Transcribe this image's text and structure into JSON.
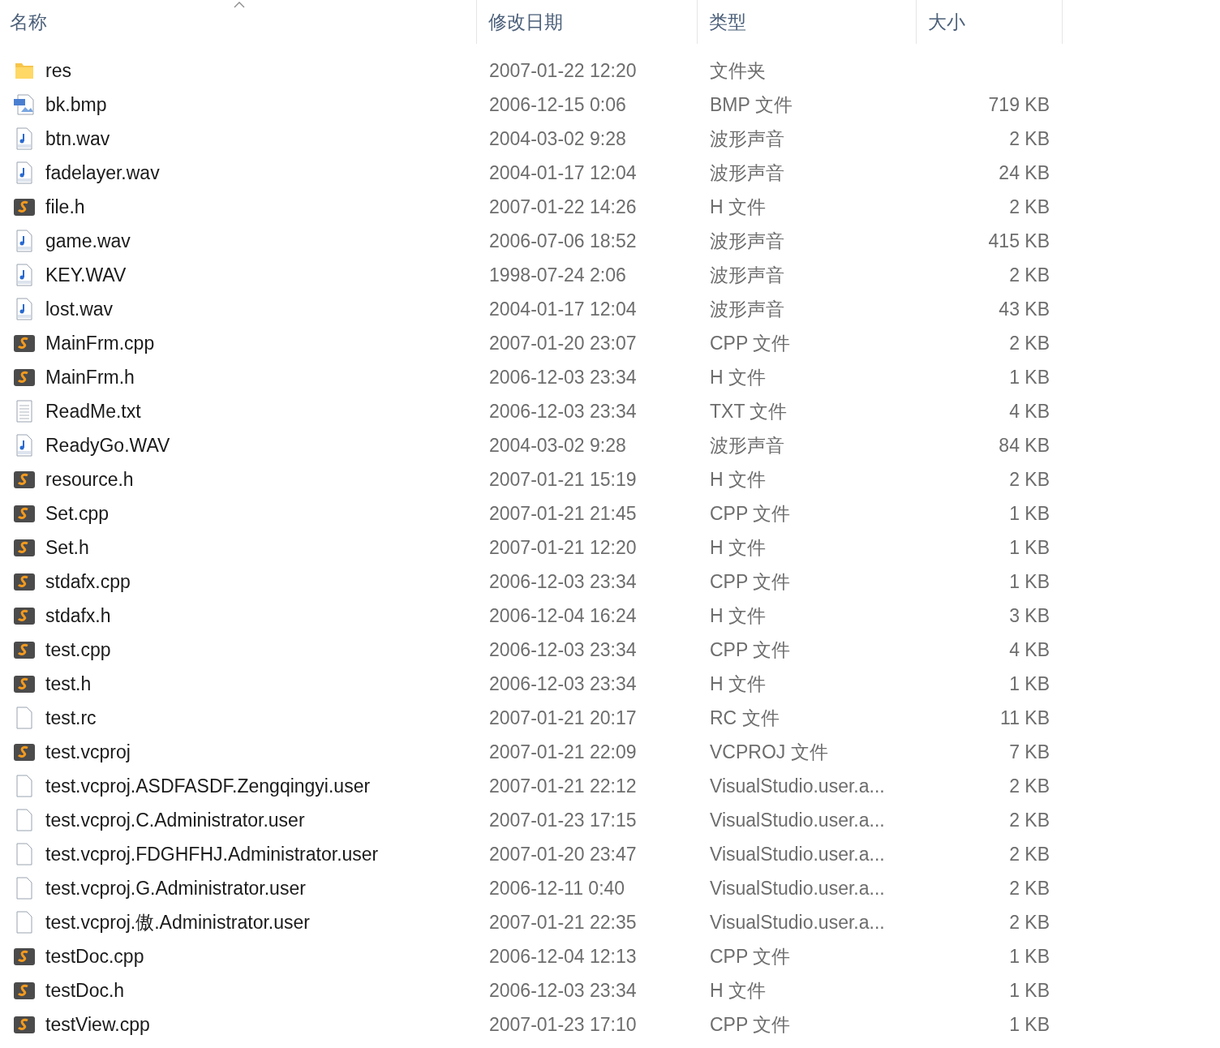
{
  "columns": [
    {
      "label": "名称",
      "sorted": true
    },
    {
      "label": "修改日期",
      "sorted": false
    },
    {
      "label": "类型",
      "sorted": false
    },
    {
      "label": "大小",
      "sorted": false
    }
  ],
  "rows": [
    {
      "kind": "folder",
      "name": "res",
      "date": "2007-01-22 12:20",
      "type": "文件夹"
    },
    {
      "kind": "bmp",
      "name": "bk.bmp",
      "date": "2006-12-15 0:06",
      "type": "BMP 文件",
      "size": "719 KB"
    },
    {
      "kind": "wav",
      "name": "btn.wav",
      "date": "2004-03-02 9:28",
      "type": "波形声音",
      "size": "2 KB"
    },
    {
      "kind": "wav",
      "name": "fadelayer.wav",
      "date": "2004-01-17 12:04",
      "type": "波形声音",
      "size": "24 KB"
    },
    {
      "kind": "code",
      "name": "file.h",
      "date": "2007-01-22 14:26",
      "type": "H 文件",
      "size": "2 KB"
    },
    {
      "kind": "wav",
      "name": "game.wav",
      "date": "2006-07-06 18:52",
      "type": "波形声音",
      "size": "415 KB"
    },
    {
      "kind": "wav",
      "name": "KEY.WAV",
      "date": "1998-07-24 2:06",
      "type": "波形声音",
      "size": "2 KB"
    },
    {
      "kind": "wav",
      "name": "lost.wav",
      "date": "2004-01-17 12:04",
      "type": "波形声音",
      "size": "43 KB"
    },
    {
      "kind": "code",
      "name": "MainFrm.cpp",
      "date": "2007-01-20 23:07",
      "type": "CPP 文件",
      "size": "2 KB"
    },
    {
      "kind": "code",
      "name": "MainFrm.h",
      "date": "2006-12-03 23:34",
      "type": "H 文件",
      "size": "1 KB"
    },
    {
      "kind": "text",
      "name": "ReadMe.txt",
      "date": "2006-12-03 23:34",
      "type": "TXT 文件",
      "size": "4 KB"
    },
    {
      "kind": "wav",
      "name": "ReadyGo.WAV",
      "date": "2004-03-02 9:28",
      "type": "波形声音",
      "size": "84 KB"
    },
    {
      "kind": "code",
      "name": "resource.h",
      "date": "2007-01-21 15:19",
      "type": "H 文件",
      "size": "2 KB"
    },
    {
      "kind": "code",
      "name": "Set.cpp",
      "date": "2007-01-21 21:45",
      "type": "CPP 文件",
      "size": "1 KB"
    },
    {
      "kind": "code",
      "name": "Set.h",
      "date": "2007-01-21 12:20",
      "type": "H 文件",
      "size": "1 KB"
    },
    {
      "kind": "code",
      "name": "stdafx.cpp",
      "date": "2006-12-03 23:34",
      "type": "CPP 文件",
      "size": "1 KB"
    },
    {
      "kind": "code",
      "name": "stdafx.h",
      "date": "2006-12-04 16:24",
      "type": "H 文件",
      "size": "3 KB"
    },
    {
      "kind": "code",
      "name": "test.cpp",
      "date": "2006-12-03 23:34",
      "type": "CPP 文件",
      "size": "4 KB"
    },
    {
      "kind": "code",
      "name": "test.h",
      "date": "2006-12-03 23:34",
      "type": "H 文件",
      "size": "1 KB"
    },
    {
      "kind": "blank",
      "name": "test.rc",
      "date": "2007-01-21 20:17",
      "type": "RC 文件",
      "size": "11 KB"
    },
    {
      "kind": "code",
      "name": "test.vcproj",
      "date": "2007-01-21 22:09",
      "type": "VCPROJ 文件",
      "size": "7 KB"
    },
    {
      "kind": "blank",
      "name": "test.vcproj.ASDFASDF.Zengqingyi.user",
      "date": "2007-01-21 22:12",
      "type": "VisualStudio.user.a...",
      "size": "2 KB"
    },
    {
      "kind": "blank",
      "name": "test.vcproj.C.Administrator.user",
      "date": "2007-01-23 17:15",
      "type": "VisualStudio.user.a...",
      "size": "2 KB"
    },
    {
      "kind": "blank",
      "name": "test.vcproj.FDGHFHJ.Administrator.user",
      "date": "2007-01-20 23:47",
      "type": "VisualStudio.user.a...",
      "size": "2 KB"
    },
    {
      "kind": "blank",
      "name": "test.vcproj.G.Administrator.user",
      "date": "2006-12-11 0:40",
      "type": "VisualStudio.user.a...",
      "size": "2 KB"
    },
    {
      "kind": "blank",
      "name": "test.vcproj.傲.Administrator.user",
      "date": "2007-01-21 22:35",
      "type": "VisualStudio.user.a...",
      "size": "2 KB"
    },
    {
      "kind": "code",
      "name": "testDoc.cpp",
      "date": "2006-12-04 12:13",
      "type": "CPP 文件",
      "size": "1 KB"
    },
    {
      "kind": "code",
      "name": "testDoc.h",
      "date": "2006-12-03 23:34",
      "type": "H 文件",
      "size": "1 KB"
    },
    {
      "kind": "code",
      "name": "testView.cpp",
      "date": "2007-01-23 17:10",
      "type": "CPP 文件",
      "size": "1 KB"
    }
  ]
}
